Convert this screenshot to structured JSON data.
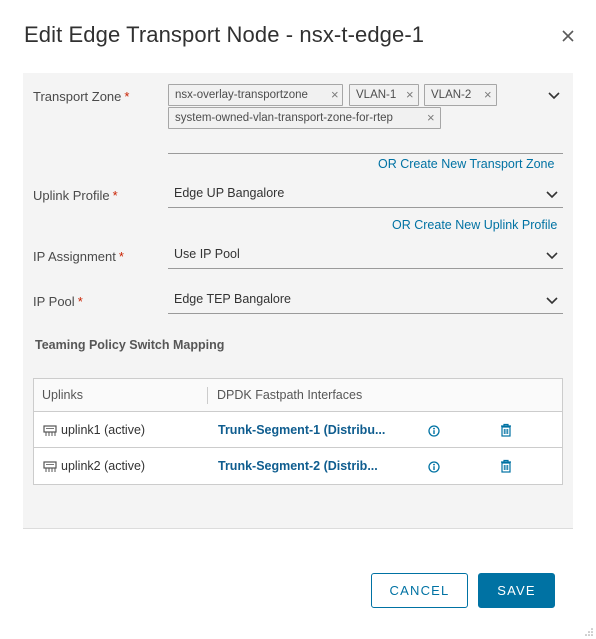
{
  "dialog": {
    "title": "Edit Edge Transport Node - nsx-t-edge-1",
    "close_icon": "close-icon"
  },
  "form": {
    "transport_zone": {
      "label": "Transport Zone",
      "required_mark": "*",
      "tags": [
        "nsx-overlay-transportzone",
        "VLAN-1",
        "VLAN-2",
        "system-owned-vlan-transport-zone-for-rtep"
      ],
      "remove_glyph": "×",
      "create_link": "OR Create New Transport Zone"
    },
    "uplink_profile": {
      "label": "Uplink Profile",
      "required_mark": "*",
      "value": "Edge UP Bangalore",
      "create_link": "OR Create New Uplink Profile"
    },
    "ip_assignment": {
      "label": "IP Assignment",
      "required_mark": "*",
      "value": "Use IP Pool"
    },
    "ip_pool": {
      "label": "IP Pool",
      "required_mark": "*",
      "value": "Edge TEP Bangalore"
    }
  },
  "teaming": {
    "title": "Teaming Policy Switch Mapping",
    "columns": [
      "Uplinks",
      "DPDK Fastpath Interfaces"
    ],
    "rows": [
      {
        "uplink": "uplink1 (active)",
        "interface": "Trunk-Segment-1 (Distribu..."
      },
      {
        "uplink": "uplink2 (active)",
        "interface": "Trunk-Segment-2 (Distrib..."
      }
    ]
  },
  "footer": {
    "cancel_label": "CANCEL",
    "save_label": "SAVE"
  },
  "colors": {
    "accent": "#0072a3",
    "required": "#c92100",
    "panel_bg": "#f4f4f4"
  }
}
